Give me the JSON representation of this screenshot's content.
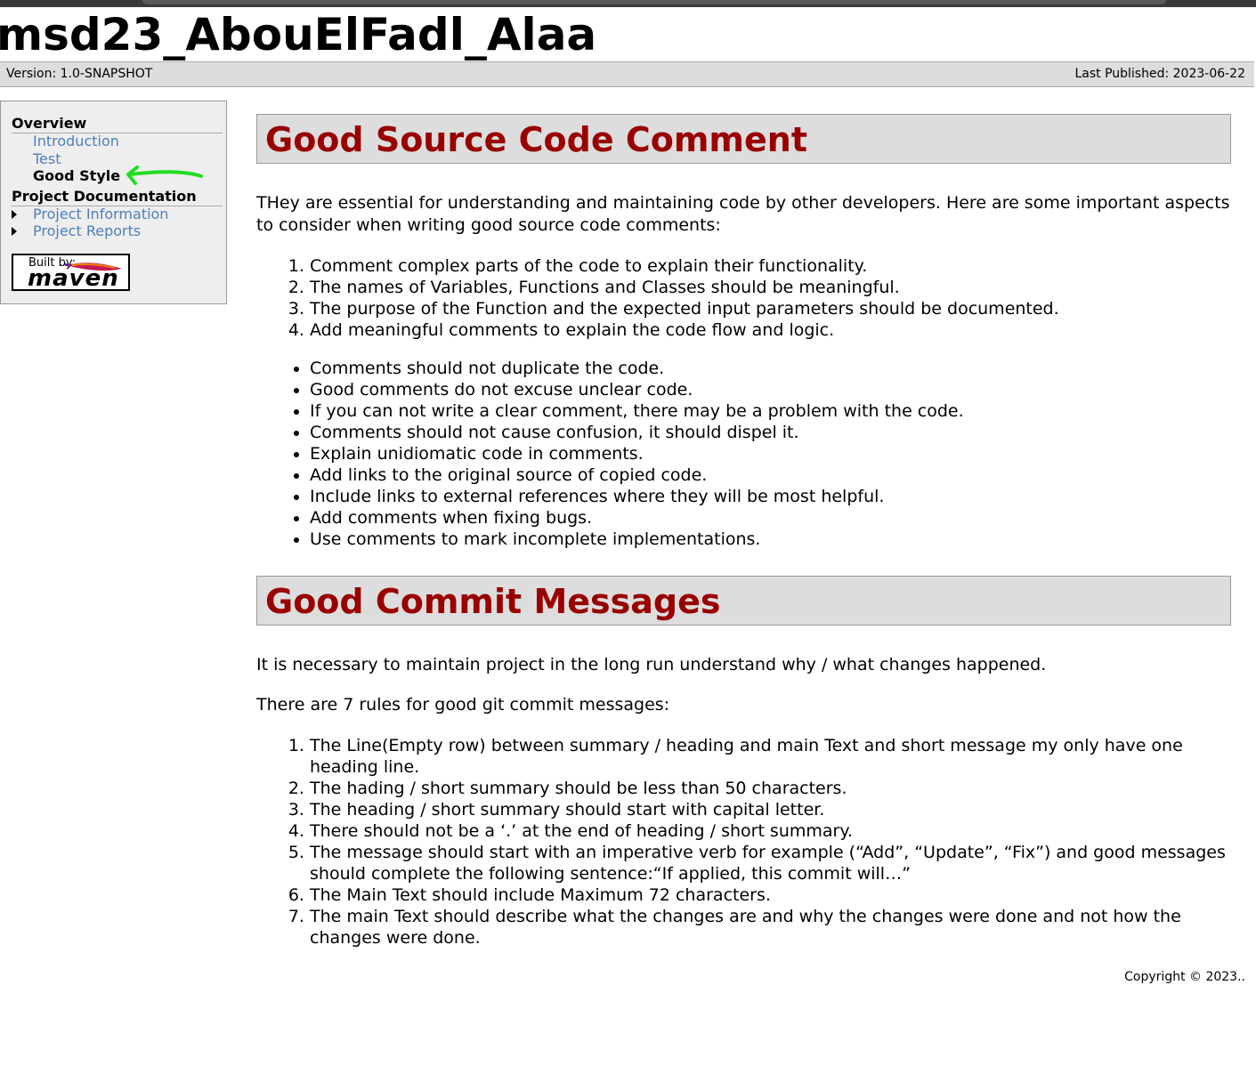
{
  "banner": {
    "title": "msd23_AbouElFadl_Alaa"
  },
  "breadcrumbs": {
    "version": "Version: 1.0-SNAPSHOT",
    "last_published": "Last Published: 2023-06-22"
  },
  "sidebar": {
    "overview_heading": "Overview",
    "overview_items": [
      {
        "label": "Introduction"
      },
      {
        "label": "Test"
      },
      {
        "label": "Good Style"
      }
    ],
    "project_doc_heading": "Project Documentation",
    "project_doc_items": [
      {
        "label": "Project Information"
      },
      {
        "label": "Project Reports"
      }
    ],
    "badge": {
      "built_by": "Built by:",
      "logo_text": "maven"
    }
  },
  "annotation": {
    "arrow_color": "#22dd22",
    "icon": "hand-drawn-arrow-icon"
  },
  "section1": {
    "title": "Good Source Code Comment",
    "intro": "THey are essential for understanding and maintaining code by other developers. Here are some important aspects to consider when writing good source code comments:",
    "ordered": [
      "Comment complex parts of the code to explain their functionality.",
      "The names of Variables, Functions and Classes should be meaningful.",
      "The purpose of the Function and the expected input parameters should be documented.",
      "Add meaningful comments to explain the code flow and logic."
    ],
    "bullets": [
      "Comments should not duplicate the code.",
      "Good comments do not excuse unclear code.",
      "If you can not write a clear comment, there may be a problem with the code.",
      "Comments should not cause confusion, it should dispel it.",
      "Explain unidiomatic code in comments.",
      "Add links to the original source of copied code.",
      "Include links to external references where they will be most helpful.",
      "Add comments when fixing bugs.",
      "Use comments to mark incomplete implementations."
    ]
  },
  "section2": {
    "title": "Good Commit Messages",
    "intro": "It is necessary to maintain project in the long run understand why / what changes happened.",
    "rules_intro": "There are 7 rules for good git commit messages:",
    "rules": [
      "The Line(Empty row) between summary / heading and main Text and short message my only have one heading line.",
      "The hading / short summary should be less than 50 characters.",
      "The heading / short summary should start with capital letter.",
      "There should not be a ‘.’ at the end of heading / short summary.",
      "The message should start with an imperative verb for example (“Add”, “Update”, “Fix”) and good messages should complete the following sentence:“If applied, this commit will…”",
      "The Main Text should include Maximum 72 characters.",
      "The main Text should describe what the changes are and why the changes were done and not how the changes were done."
    ]
  },
  "footer": {
    "copyright": "Copyright © 2023.."
  },
  "colors": {
    "section_title": "#990000",
    "link": "#4f7fb8",
    "title_bar_bg": "#dddddd",
    "sidebar_bg": "#eeeeee"
  }
}
